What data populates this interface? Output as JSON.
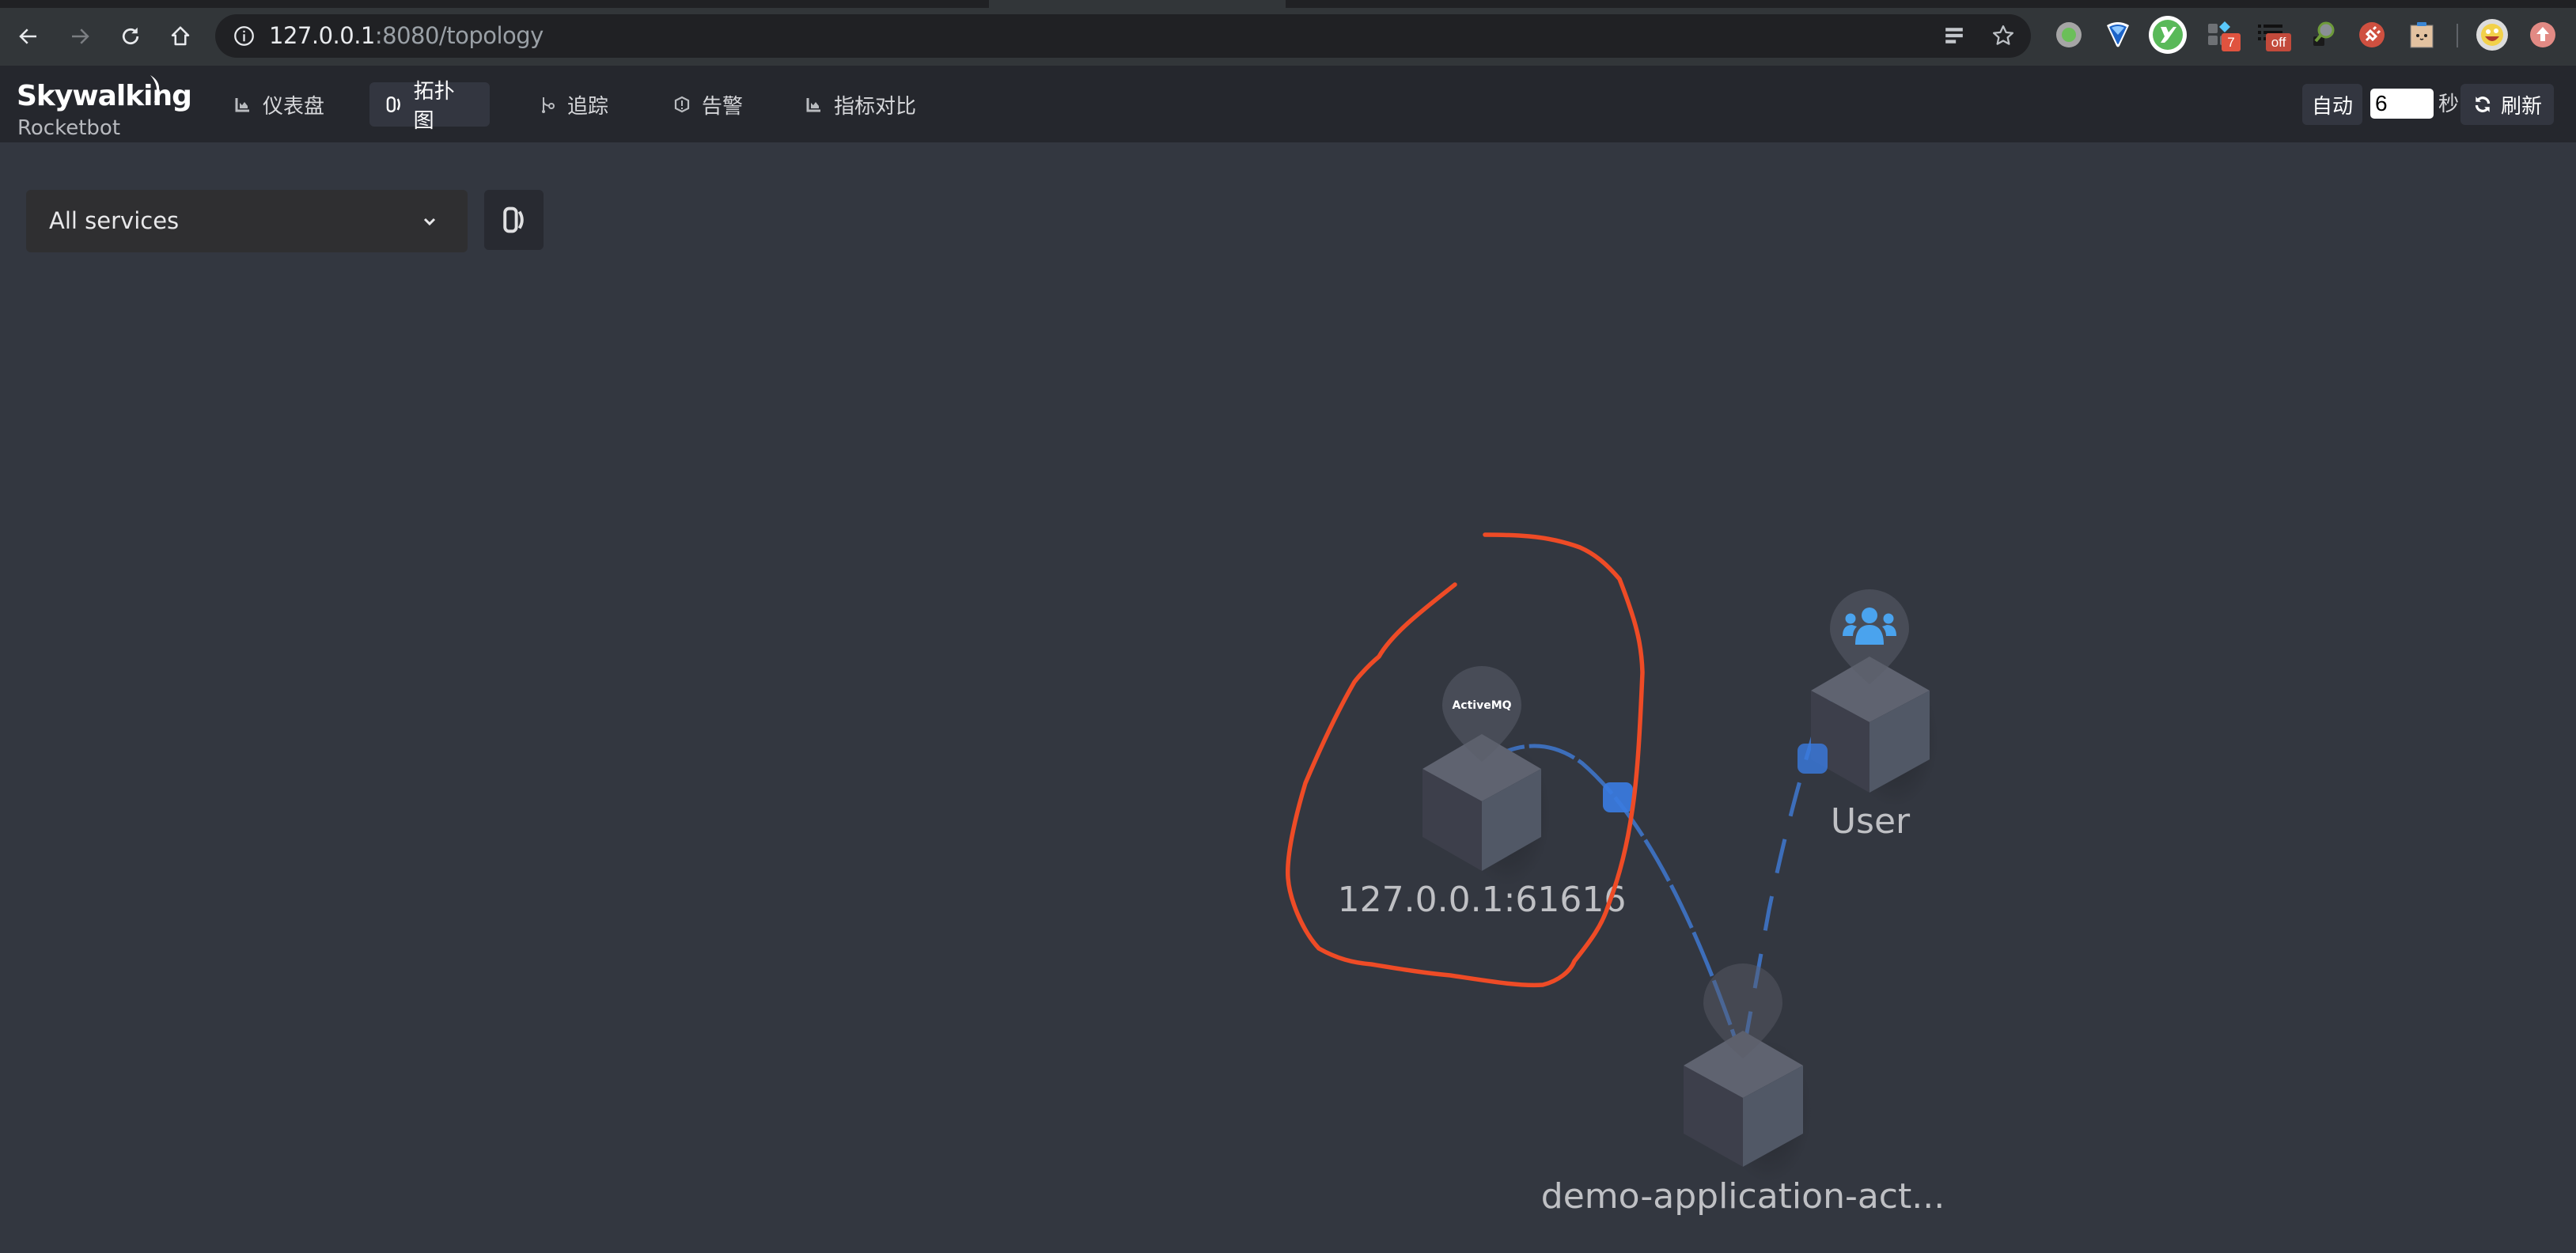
{
  "browser": {
    "url_host": "127.0.0.1",
    "url_rest": ":8080/topology",
    "toolbar_icons": [
      "back-icon",
      "forward-icon",
      "reload-icon",
      "home-icon",
      "site-info-icon",
      "reader-mode-icon",
      "bookmark-star-icon"
    ],
    "extensions": [
      {
        "name": "status-dot-extension",
        "badge": ""
      },
      {
        "name": "pin-extension",
        "badge": ""
      },
      {
        "name": "yapi-extension",
        "badge": ""
      },
      {
        "name": "apps-grid-extension",
        "badge": "7"
      },
      {
        "name": "list-extension",
        "badge": "off"
      },
      {
        "name": "magnifier-extension",
        "badge": ""
      },
      {
        "name": "plug-extension",
        "badge": ""
      },
      {
        "name": "box-face-extension",
        "badge": ""
      },
      {
        "name": "profile-avatar",
        "badge": ""
      },
      {
        "name": "update-extension",
        "badge": ""
      }
    ]
  },
  "header": {
    "logo_title": "Skywalking",
    "logo_subtitle": "Rocketbot",
    "nav": [
      {
        "label": "仪表盘",
        "icon": "chart-icon",
        "active": false
      },
      {
        "label": "拓扑图",
        "icon": "topology-icon",
        "active": true
      },
      {
        "label": "追踪",
        "icon": "trace-icon",
        "active": false
      },
      {
        "label": "告警",
        "icon": "alert-icon",
        "active": false
      },
      {
        "label": "指标对比",
        "icon": "chart-icon",
        "active": false
      }
    ],
    "auto_label": "自动",
    "interval_value": "6",
    "seconds_label": "秒",
    "refresh_label": "刷新"
  },
  "filter": {
    "service_selected": "All services"
  },
  "topology": {
    "nodes": [
      {
        "id": "activemq",
        "label": "127.0.0.1:61616",
        "type_badge": "ActiveMQ"
      },
      {
        "id": "user",
        "label": "User",
        "type_badge": "user-group-icon"
      },
      {
        "id": "demo",
        "label": "demo-application-act..."
      }
    ],
    "links": [
      {
        "source": "demo",
        "target": "activemq",
        "style": "dashed-solid"
      },
      {
        "source": "user",
        "target": "demo",
        "style": "dashed"
      }
    ],
    "colors": {
      "link": "#3f78d0",
      "link_marker": "#3a7be0",
      "user_icon": "#4aa3ee",
      "annotation": "#ee4b26"
    }
  }
}
